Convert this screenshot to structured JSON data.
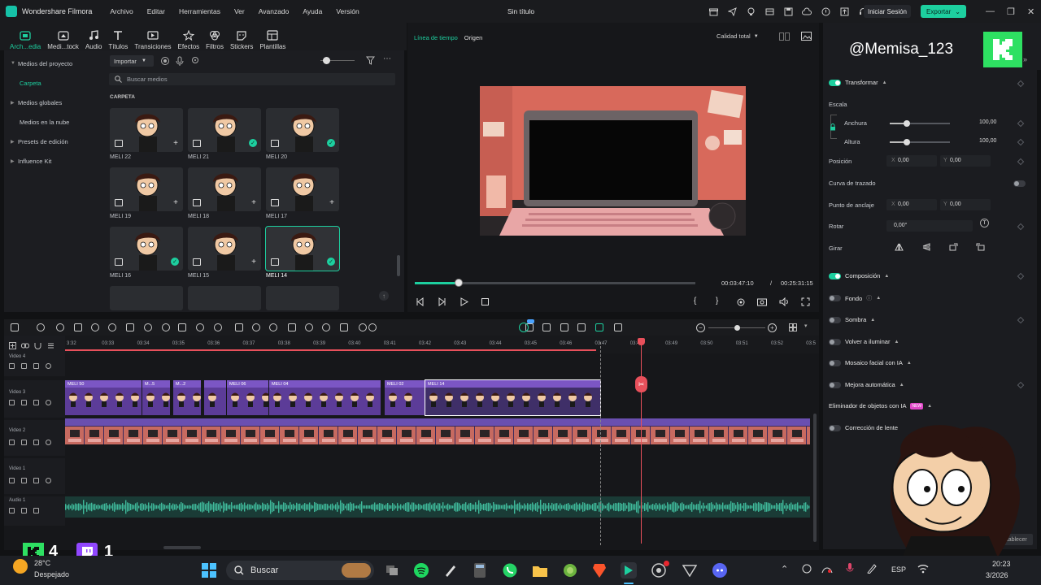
{
  "titlebar": {
    "app_name": "Wondershare Filmora",
    "menu": [
      "Archivo",
      "Editar",
      "Herramientas",
      "Ver",
      "Avanzado",
      "Ayuda",
      "Versión"
    ],
    "doc_title": "Sin título",
    "login_label": "Iniciar Sesión",
    "export_label": "Exportar"
  },
  "toolbar": {
    "tabs": [
      {
        "label": "Arch...edia",
        "icon": "folder-icon"
      },
      {
        "label": "Medi...tock",
        "icon": "stock-media-icon"
      },
      {
        "label": "Audio",
        "icon": "music-note-icon"
      },
      {
        "label": "Títulos",
        "icon": "text-t-icon"
      },
      {
        "label": "Transiciones",
        "icon": "transition-icon"
      },
      {
        "label": "Efectos",
        "icon": "effects-icon"
      },
      {
        "label": "Filtros",
        "icon": "filter-icon"
      },
      {
        "label": "Stickers",
        "icon": "sticker-icon"
      },
      {
        "label": "Plantillas",
        "icon": "template-icon"
      }
    ]
  },
  "left_panel": {
    "items": [
      {
        "label": "Medios del proyecto"
      },
      {
        "label": "Carpeta"
      },
      {
        "label": "Medios globales"
      },
      {
        "label": "Medios en la nube"
      },
      {
        "label": "Presets de edición"
      },
      {
        "label": "Influence Kit"
      }
    ]
  },
  "media": {
    "import_label": "Importar",
    "search_placeholder": "Buscar medios",
    "section_label": "CARPETA",
    "items": [
      {
        "label": "MELI 22",
        "state": "add"
      },
      {
        "label": "MELI 21",
        "state": "check"
      },
      {
        "label": "MELI 20",
        "state": "check"
      },
      {
        "label": "MELI 19",
        "state": "add"
      },
      {
        "label": "MELI 18",
        "state": "add"
      },
      {
        "label": "MELI 17",
        "state": "add"
      },
      {
        "label": "MELI 16",
        "state": "check"
      },
      {
        "label": "MELI 15",
        "state": "add"
      },
      {
        "label": "MELI 14",
        "state": "check"
      }
    ]
  },
  "preview": {
    "tab_timeline": "Línea de tiempo",
    "tab_source": "Origen",
    "quality_label": "Calidad total",
    "current_time": "00:03:47:10",
    "separator": "/",
    "total_time": "00:25:31:15",
    "progress_fraction": 0.155
  },
  "inspector": {
    "overlay_name": "@Memisa_123",
    "transform_label": "Transformar",
    "scale_label": "Escala",
    "width_label": "Anchura",
    "width_value": "100,00",
    "height_label": "Altura",
    "height_value": "100,00",
    "position_label": "Posición",
    "pos_x_label": "X",
    "pos_x": "0,00",
    "pos_y_label": "Y",
    "pos_y": "0,00",
    "path_label": "Curva de trazado",
    "anchor_label": "Punto de anclaje",
    "anchor_x": "0,00",
    "anchor_y": "0,00",
    "rotate_label": "Rotar",
    "rotate_value": "0,00°",
    "flip_label": "Girar",
    "composition_label": "Composición",
    "background_label": "Fondo",
    "shadow_label": "Sombra",
    "relight_label": "Volver a iluminar",
    "face_mosaic_label": "Mosaico facial con IA",
    "auto_enhance_label": "Mejora automática",
    "object_remover_label": "Eliminador de objetos con IA",
    "new_badge": "NEW",
    "lens_correction_label": "Corrección de lente",
    "reset_label": "Restablecer"
  },
  "timeline": {
    "ticks": [
      "3:32",
      "03:33",
      "03:34",
      "03:35",
      "03:36",
      "03:37",
      "03:38",
      "03:39",
      "03:40",
      "03:41",
      "03:42",
      "03:43",
      "03:44",
      "03:45",
      "03:46",
      "03:47",
      "03:48",
      "03:49",
      "03:50",
      "03:51",
      "03:52",
      "03:5"
    ],
    "tracks": [
      {
        "name": "Video 4"
      },
      {
        "name": "Video 3"
      },
      {
        "name": "Video 2"
      },
      {
        "name": "Video 1"
      },
      {
        "name": "Audio 1"
      }
    ],
    "clips": [
      {
        "label": "MELI 50"
      },
      {
        "label": "M...5"
      },
      {
        "label": "M...2"
      },
      {
        "label": "MELI 06"
      },
      {
        "label": "MELI 04"
      },
      {
        "label": "MELI 02"
      },
      {
        "label": "MELI 14"
      }
    ]
  },
  "stream_overlay": {
    "kick_count": "4",
    "twitch_count": "1"
  },
  "taskbar": {
    "weather_temp": "28°C",
    "weather_desc": "Despejado",
    "search_label": "Buscar",
    "lang": "ESP",
    "time": "20:23",
    "date": "3/2026"
  },
  "colors": {
    "accent": "#1dcf9f",
    "clip_purple": "#5c3c98",
    "playhead": "#e8505b",
    "kick_green": "#2ee062",
    "twitch_purple": "#9147ff"
  }
}
